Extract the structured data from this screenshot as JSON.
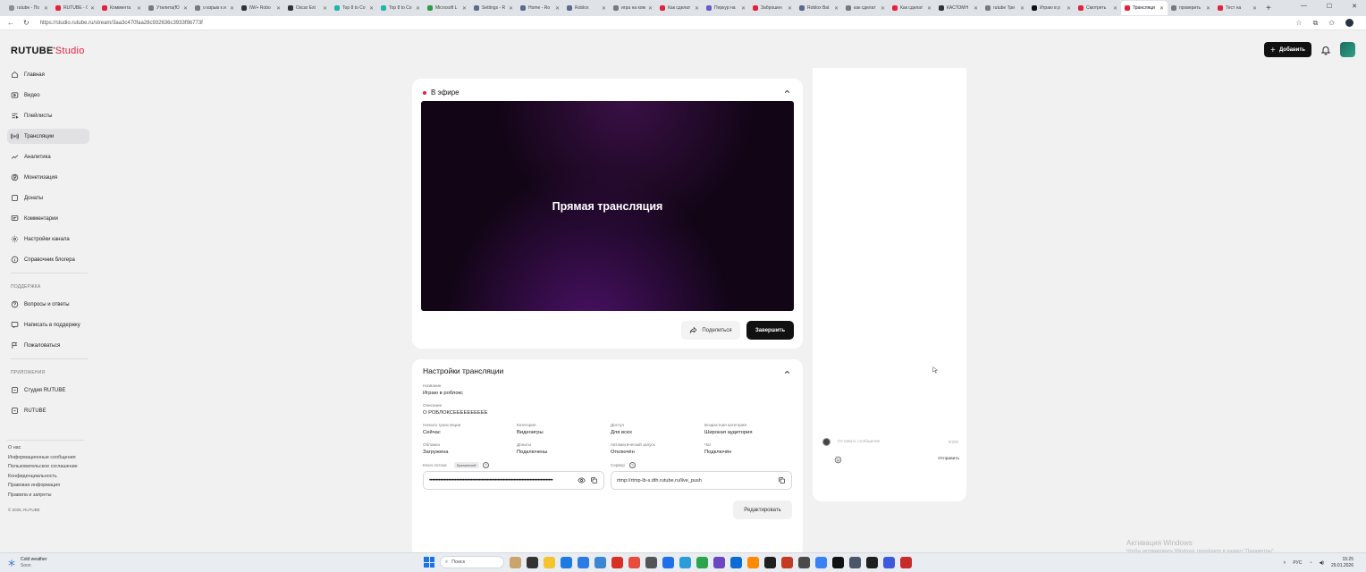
{
  "browser": {
    "tabs": [
      {
        "title": "rutube - По",
        "color": "#8a8f98",
        "active": false
      },
      {
        "title": "RUTUBE - С",
        "color": "#e5213c",
        "active": false
      },
      {
        "title": "Коммента",
        "color": "#e5213c",
        "active": false
      },
      {
        "title": "Утилита(Ю",
        "color": "#7a7a7a",
        "active": false
      },
      {
        "title": "о взрыв к и",
        "color": "#7a7a7a",
        "active": false
      },
      {
        "title": "IW/+ Robo",
        "color": "#333333",
        "active": false
      },
      {
        "title": "Oscar Ext",
        "color": "#333333",
        "active": false
      },
      {
        "title": "Top 8 to Co",
        "color": "#22b5a5",
        "active": false
      },
      {
        "title": "Top 8 to Co",
        "color": "#22b5a5",
        "active": false
      },
      {
        "title": "Microsoft L",
        "color": "#2a9d4a",
        "active": false
      },
      {
        "title": "Settings - R",
        "color": "#5a6b8c",
        "active": false
      },
      {
        "title": "Home - Ro",
        "color": "#5a6b8c",
        "active": false
      },
      {
        "title": "Roblox",
        "color": "#5a6b8c",
        "active": false
      },
      {
        "title": "игра на ком",
        "color": "#7a7a7a",
        "active": false
      },
      {
        "title": "Как сделат",
        "color": "#e5213c",
        "active": false
      },
      {
        "title": "Перкур на",
        "color": "#6b5acd",
        "active": false
      },
      {
        "title": "Заброшен",
        "color": "#e5213c",
        "active": false
      },
      {
        "title": "Roblox Bat",
        "color": "#5a6b8c",
        "active": false
      },
      {
        "title": "как сделат",
        "color": "#7a7a7a",
        "active": false
      },
      {
        "title": "Как сделат",
        "color": "#e5213c",
        "active": false
      },
      {
        "title": "КАСТОМН",
        "color": "#333333",
        "active": false
      },
      {
        "title": "rutube Три",
        "color": "#7a7a7a",
        "active": false
      },
      {
        "title": "Играю в р",
        "color": "#111111",
        "active": false
      },
      {
        "title": "Смотреть",
        "color": "#e5213c",
        "active": false
      },
      {
        "title": "Трансляци",
        "color": "#e5213c",
        "active": true
      },
      {
        "title": "проверить",
        "color": "#7a7a7a",
        "active": false
      },
      {
        "title": "Тест на",
        "color": "#e5213c",
        "active": false
      }
    ],
    "new_tab": "+",
    "url": "https://studio.rutube.ru/stream/3aa3c470faa28c932636c3933f9b773f"
  },
  "brand": {
    "name": "RUTUBE",
    "studio": "Studio",
    "accent": "#e5213c"
  },
  "sidebar": {
    "main": [
      {
        "label": "Главная",
        "icon": "home-icon"
      },
      {
        "label": "Видео",
        "icon": "video-icon"
      },
      {
        "label": "Плейлисты",
        "icon": "playlist-icon"
      },
      {
        "label": "Трансляции",
        "icon": "broadcast-icon",
        "active": true
      },
      {
        "label": "Аналитика",
        "icon": "analytics-icon"
      },
      {
        "label": "Монетизация",
        "icon": "monetization-icon"
      },
      {
        "label": "Донаты",
        "icon": "donate-icon"
      },
      {
        "label": "Комментарии",
        "icon": "comments-icon"
      },
      {
        "label": "Настройки канала",
        "icon": "settings-icon"
      },
      {
        "label": "Справочник блогера",
        "icon": "info-icon"
      }
    ],
    "support_title": "ПОДДЕРЖКА",
    "support": [
      {
        "label": "Вопросы и ответы",
        "icon": "help-icon"
      },
      {
        "label": "Написать в поддержку",
        "icon": "chat-icon"
      },
      {
        "label": "Пожаловаться",
        "icon": "flag-icon"
      }
    ],
    "apps_title": "ПРИЛОЖЕНИЯ",
    "apps": [
      {
        "label": "Студия RUTUBE",
        "icon": "app-icon"
      },
      {
        "label": "RUTUBE",
        "icon": "app-icon"
      }
    ],
    "footer": [
      "О нас",
      "Информационные сообщения",
      "Пользовательское соглашение",
      "Конфиденциальность",
      "Правовая информация",
      "Правила и запреты"
    ],
    "copyright": "© 2025, RUTUBE"
  },
  "header": {
    "add_label": "Добавить"
  },
  "live": {
    "status": "В эфире",
    "player_text": "Прямая трансляция",
    "share_label": "Поделиться",
    "finish_label": "Завершить"
  },
  "settings": {
    "title": "Настройки трансляции",
    "name_label": "Название",
    "name_value": "Играю в роблокс",
    "desc_label": "Описание",
    "desc_value": "О РОБЛОКСЕЕЕЕЕЕЕЕЕЕ",
    "grid": [
      {
        "label": "Начало трансляции",
        "value": "Сейчас"
      },
      {
        "label": "Категория",
        "value": "Видеоигры"
      },
      {
        "label": "Доступ",
        "value": "Для всех"
      },
      {
        "label": "Возрастная категория",
        "value": "Широкая аудитория"
      },
      {
        "label": "Обложка",
        "value": "Загружена"
      },
      {
        "label": "Донаты",
        "value": "Подключены"
      },
      {
        "label": "Автоматический запуск",
        "value": "Отключён"
      },
      {
        "label": "Чат",
        "value": "Подключён"
      }
    ],
    "key_label": "Ключ потока",
    "key_badge": "Временный",
    "key_value": "••••••••••••••••••••••••••••••••••••••••••••••••••••••••••••••••••••••••••••••••••••••••••••",
    "server_label": "Сервер",
    "server_value": "rtmp://rtmp-lb-s.dth.rutube.ru/live_push",
    "edit_label": "Редактировать"
  },
  "chat": {
    "placeholder": "Оставить сообщение",
    "counter": "0/200",
    "send_label": "Отправить"
  },
  "windows": {
    "activation_title": "Активация Windows",
    "activation_sub": "Чтобы активировать Windows, перейдите в раздел \"Параметры\".",
    "weather_title": "Cold weather",
    "weather_sub": "Soon",
    "search_placeholder": "Поиск",
    "lang": "РУС",
    "time": "15:25",
    "date": "29.01.2026"
  }
}
